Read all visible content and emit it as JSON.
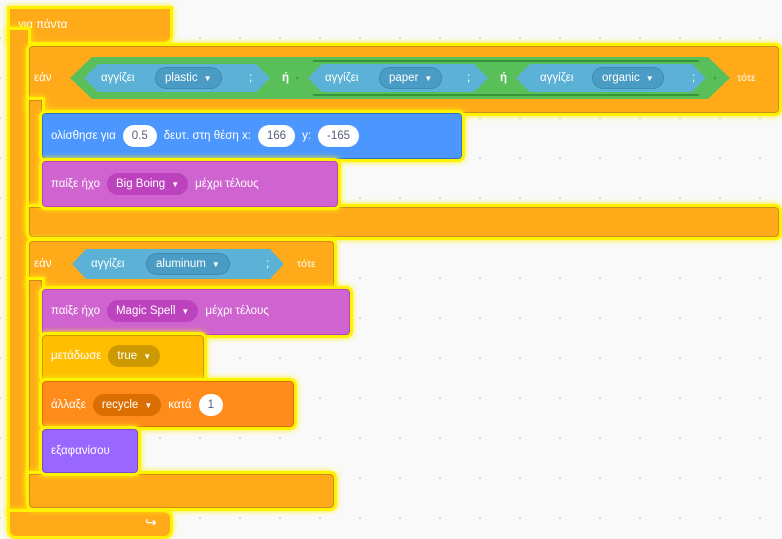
{
  "forever": {
    "label": "για πάντα",
    "loop_icon": "loop-arrow-icon"
  },
  "if1": {
    "if_label": "εάν",
    "then_label": "τότε",
    "or_label": "ή",
    "touching": "αγγίζει",
    "items": [
      "plastic",
      "paper",
      "organic"
    ],
    "glide": {
      "label": "ολίσθησε για",
      "secs": "0.5",
      "mid": "δευτ. στη θέση x:",
      "x": "166",
      "ylabel": "y:",
      "y": "-165"
    },
    "sound": {
      "label": "παίξε ήχο",
      "value": "Big Boing",
      "until": "μέχρι τέλους"
    }
  },
  "if2": {
    "if_label": "εάν",
    "then_label": "τότε",
    "touching": "αγγίζει",
    "item": "aluminum",
    "sound": {
      "label": "παίξε ήχο",
      "value": "Magic Spell",
      "until": "μέχρι τέλους"
    },
    "broadcast": {
      "label": "μετάδωσε",
      "value": "true"
    },
    "change": {
      "label": "άλλαξε",
      "var": "recycle",
      "by": "κατά",
      "amount": "1"
    },
    "hide": {
      "label": "εξαφανίσου"
    }
  },
  "colors": {
    "control": "#ffab19",
    "operator": "#59c059",
    "sensing": "#5cb1d6",
    "motion": "#4c97ff",
    "sound": "#cf63cf",
    "looks": "#9966ff",
    "events": "#ffbf00",
    "variables": "#ff8c1a",
    "highlight": "#fff200"
  }
}
